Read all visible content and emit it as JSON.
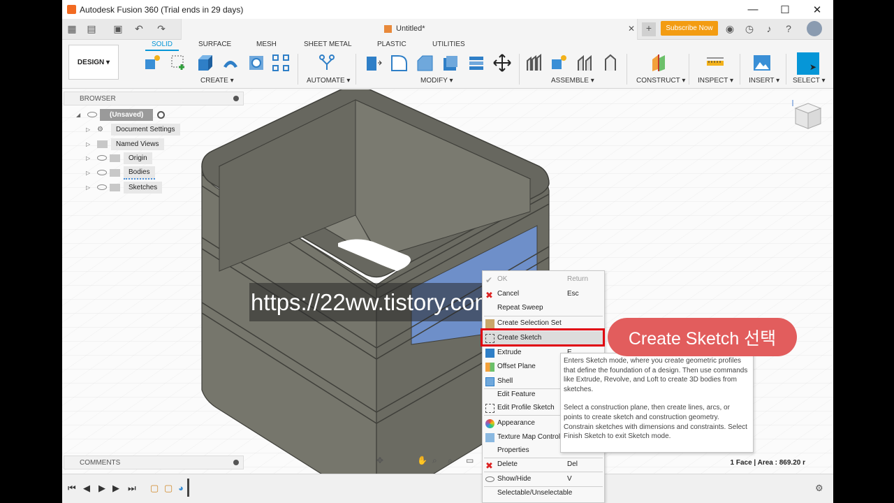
{
  "window": {
    "title": "Autodesk Fusion 360 (Trial ends in 29 days)",
    "controls": [
      "—",
      "☐",
      "✕"
    ]
  },
  "quickaccess": {
    "doc_title": "Untitled*",
    "subscribe_label": "Subscribe Now"
  },
  "toolbar": {
    "design_label": "DESIGN ▾",
    "tabs": [
      "SOLID",
      "SURFACE",
      "MESH",
      "SHEET METAL",
      "PLASTIC",
      "UTILITIES"
    ],
    "groups": [
      "CREATE ▾",
      "AUTOMATE ▾",
      "MODIFY ▾",
      "ASSEMBLE ▾",
      "CONSTRUCT ▾",
      "INSPECT ▾",
      "INSERT ▾",
      "SELECT ▾"
    ]
  },
  "browser": {
    "title": "BROWSER",
    "items": [
      "(Unsaved)",
      "Document Settings",
      "Named Views",
      "Origin",
      "Bodies",
      "Sketches"
    ]
  },
  "comments": {
    "title": "COMMENTS"
  },
  "status": {
    "selection": "1 Face | Area : 869.20 r"
  },
  "watermark": {
    "text": "https://22ww.tistory.com"
  },
  "context_menu": {
    "items": [
      {
        "label": "OK",
        "key": "Return"
      },
      {
        "label": "Cancel",
        "key": "Esc"
      },
      {
        "label": "Repeat Sweep",
        "key": ""
      },
      {
        "label": "Create Selection Set",
        "key": ""
      },
      {
        "label": "Create Sketch",
        "key": ""
      },
      {
        "label": "Extrude",
        "key": "E"
      },
      {
        "label": "Offset Plane",
        "key": ""
      },
      {
        "label": "Shell",
        "key": ""
      },
      {
        "label": "Edit Feature",
        "key": ""
      },
      {
        "label": "Edit Profile Sketch",
        "key": ""
      },
      {
        "label": "Appearance",
        "key": ""
      },
      {
        "label": "Texture Map Controls",
        "key": ""
      },
      {
        "label": "Properties",
        "key": ""
      },
      {
        "label": "Delete",
        "key": "Del"
      },
      {
        "label": "Show/Hide",
        "key": "V"
      },
      {
        "label": "Selectable/Unselectable",
        "key": ""
      }
    ]
  },
  "tooltip": {
    "p1": "Enters Sketch mode, where you create geometric profiles that define the foundation of a design. Then use commands like Extrude, Revolve, and Loft to create 3D bodies from sketches.",
    "p2": "Select a construction plane, then create lines, arcs, or points to create sketch and construction geometry. Constrain sketches with dimensions and constraints. Select Finish Sketch to exit Sketch mode."
  },
  "callout": {
    "text": "Create Sketch 선택"
  },
  "colors": {
    "accent": "#0696d7",
    "subscribe": "#f39c12",
    "highlight_box": "#e0000f",
    "callout": "#e25d5d",
    "face_selected": "#6e8fc9"
  }
}
